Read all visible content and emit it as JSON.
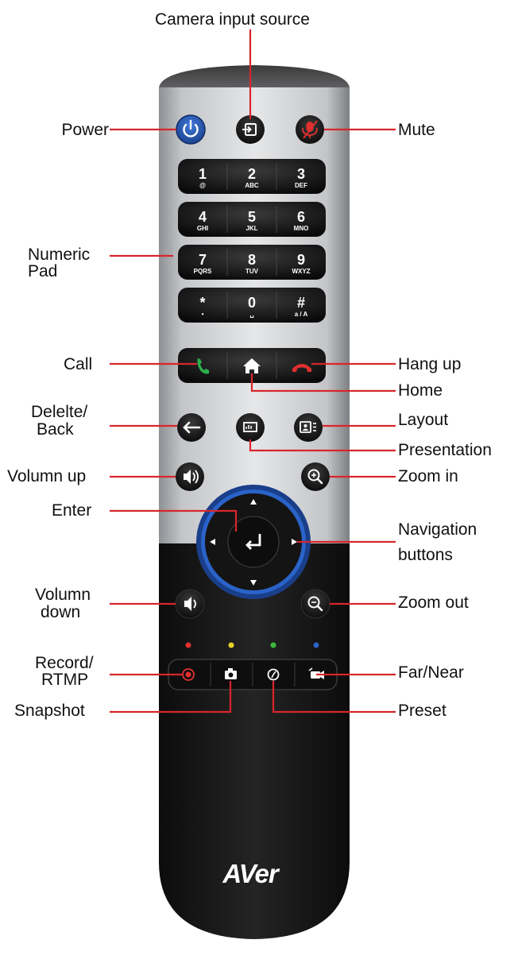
{
  "labels": {
    "camera_input_source": "Camera input source",
    "power": "Power",
    "mute": "Mute",
    "numeric_pad": [
      "Numeric",
      "Pad"
    ],
    "call": "Call",
    "hang_up": "Hang up",
    "home": "Home",
    "delete_back": [
      "Delelte/",
      "Back"
    ],
    "layout": "Layout",
    "presentation": "Presentation",
    "volume_up": "Volumn up",
    "zoom_in": "Zoom in",
    "enter": "Enter",
    "navigation": [
      "Navigation",
      "buttons"
    ],
    "volume_down": [
      "Volumn",
      "down"
    ],
    "zoom_out": "Zoom out",
    "record": [
      "Record/",
      "RTMP"
    ],
    "far_near": "Far/Near",
    "snapshot": "Snapshot",
    "preset": "Preset"
  },
  "keypad": [
    {
      "digit": "1",
      "letters": "@"
    },
    {
      "digit": "2",
      "letters": "ABC"
    },
    {
      "digit": "3",
      "letters": "DEF"
    },
    {
      "digit": "4",
      "letters": "GHI"
    },
    {
      "digit": "5",
      "letters": "JKL"
    },
    {
      "digit": "6",
      "letters": "MNO"
    },
    {
      "digit": "7",
      "letters": "PQRS"
    },
    {
      "digit": "8",
      "letters": "TUV"
    },
    {
      "digit": "9",
      "letters": "WXYZ"
    },
    {
      "digit": "*",
      "letters": "•"
    },
    {
      "digit": "0",
      "letters": "␣"
    },
    {
      "digit": "#",
      "letters": "a / A"
    }
  ],
  "brand": "AVer",
  "colors": {
    "callout": "#d8262c",
    "remote_silver": "#c9cbce",
    "remote_black": "#1c1c1c",
    "power": "#2a5cb8",
    "call_green": "#2bb24c",
    "hangup_red": "#e0302f",
    "ring_blue": "#2a63c9",
    "dot_red": "#e0302f",
    "dot_yellow": "#e6d22b",
    "dot_green": "#3dbb3d",
    "dot_blue": "#2a63c9"
  }
}
